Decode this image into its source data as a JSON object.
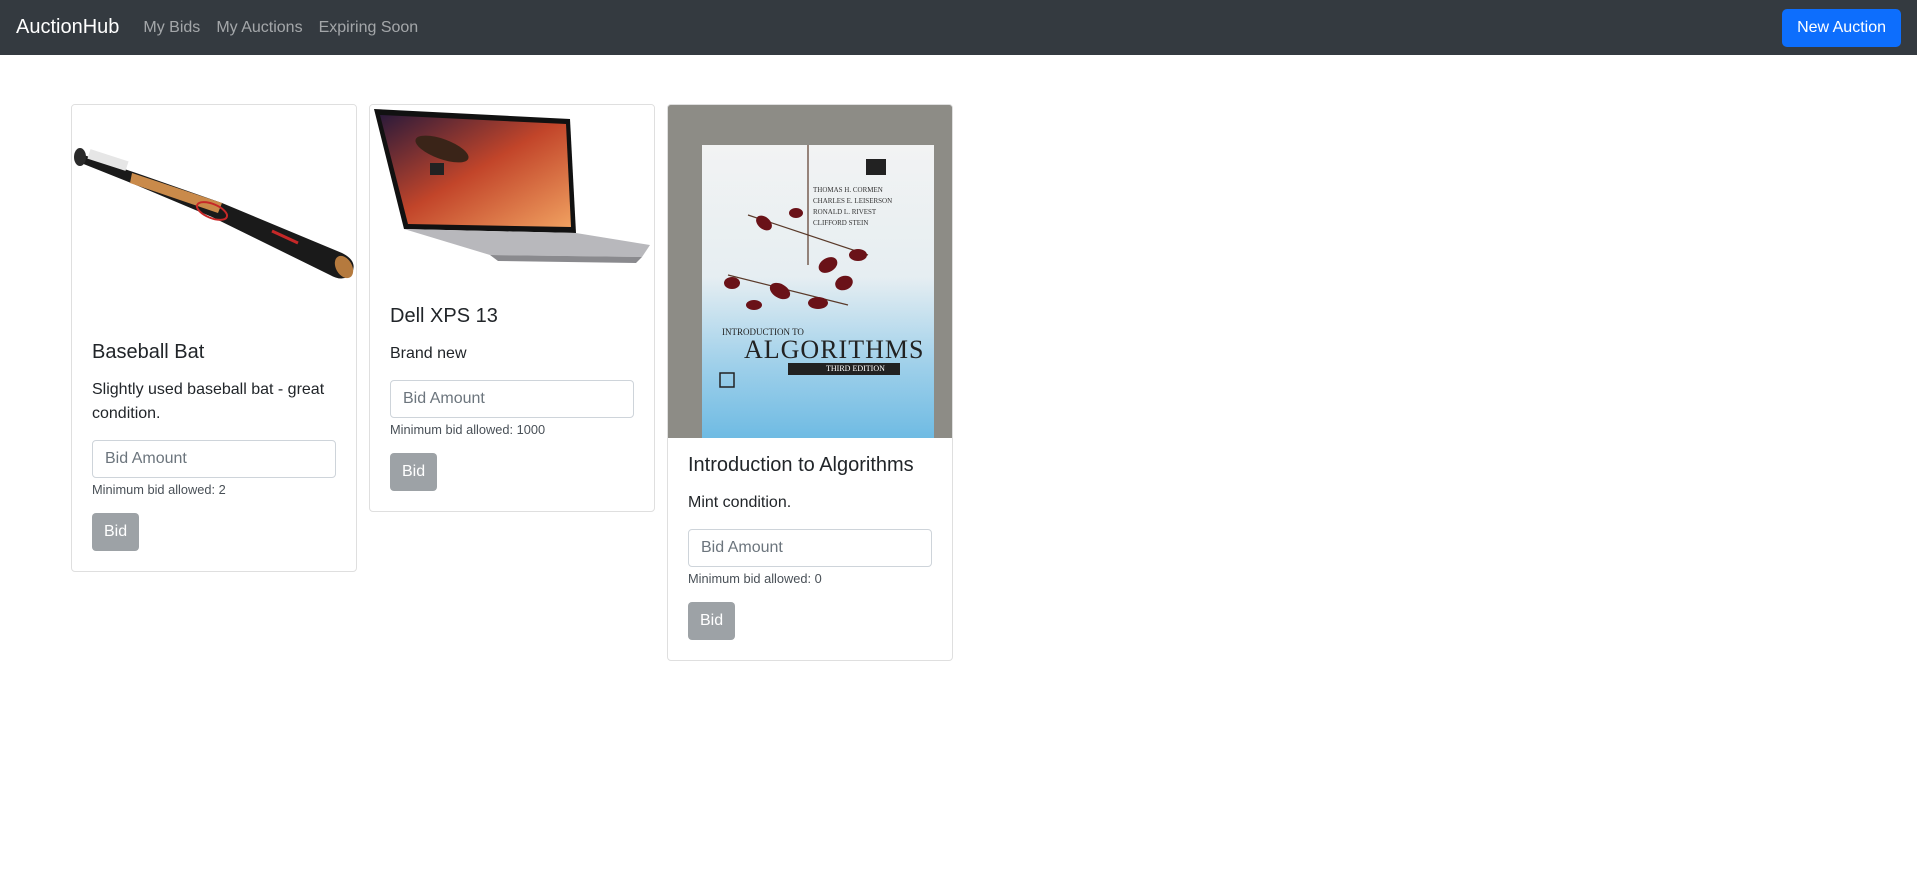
{
  "navbar": {
    "brand": "AuctionHub",
    "links": [
      "My Bids",
      "My Auctions",
      "Expiring Soon"
    ],
    "new_auction_label": "New Auction"
  },
  "auctions": [
    {
      "title": "Baseball Bat",
      "description": "Slightly used baseball bat - great condition.",
      "bid_placeholder": "Bid Amount",
      "min_bid_text": "Minimum bid allowed: 2",
      "bid_label": "Bid",
      "image_icon": "baseball-bat-image"
    },
    {
      "title": "Dell XPS 13",
      "description": "Brand new",
      "bid_placeholder": "Bid Amount",
      "min_bid_text": "Minimum bid allowed: 1000",
      "bid_label": "Bid",
      "image_icon": "laptop-image"
    },
    {
      "title": "Introduction to Algorithms",
      "description": "Mint condition.",
      "bid_placeholder": "Bid Amount",
      "min_bid_text": "Minimum bid allowed: 0",
      "bid_label": "Bid",
      "image_icon": "book-cover-image",
      "book_cover": {
        "authors": [
          "THOMAS H. CORMEN",
          "CHARLES E. LEISERSON",
          "RONALD L. RIVEST",
          "CLIFFORD STEIN"
        ],
        "title_small": "INTRODUCTION TO",
        "title_large": "ALGORITHMS",
        "edition": "THIRD EDITION"
      }
    }
  ],
  "colors": {
    "navbar_bg": "#343a40",
    "primary": "#0d6efd",
    "bid_button": "#9da2a6"
  }
}
